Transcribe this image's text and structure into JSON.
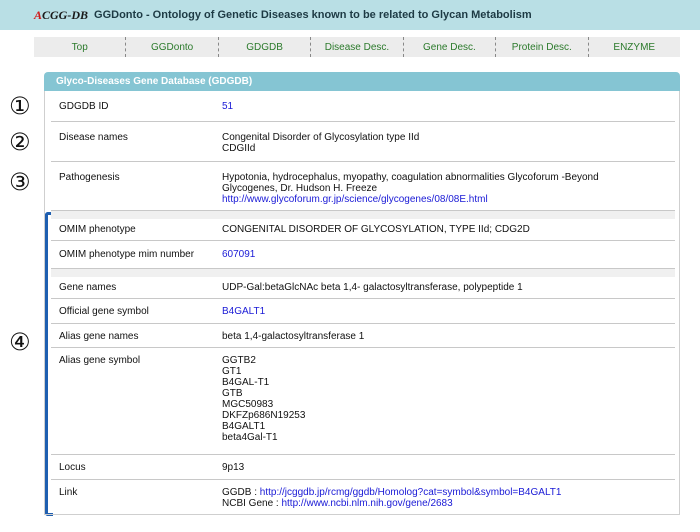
{
  "header": {
    "logo_a": "A",
    "logo_rest": "CGG-DB",
    "title": "GGDonto - Ontology of Genetic Diseases known to be related to Glycan Metabolism"
  },
  "nav": [
    "Top",
    "GGDonto",
    "GDGDB",
    "Disease Desc.",
    "Gene Desc.",
    "Protein Desc.",
    "ENZYME"
  ],
  "section_title": "Glyco-Diseases Gene Database (GDGDB)",
  "markers": [
    "①",
    "②",
    "③",
    "④"
  ],
  "rows": {
    "gdgdb_id": {
      "key": "GDGDB ID",
      "value": "51"
    },
    "disease_names": {
      "key": "Disease names",
      "lines": [
        "Congenital Disorder of Glycosylation type IId",
        "CDGIId"
      ]
    },
    "pathogenesis": {
      "key": "Pathogenesis",
      "lines": [
        "Hypotonia, hydrocephalus, myopathy, coagulation abnormalities Glycoforum -Beyond",
        "Glycogenes, Dr. Hudson H. Freeze"
      ],
      "link": "http://www.glycoforum.gr.jp/science/glycogenes/08/08E.html"
    },
    "omim_phenotype": {
      "key": "OMIM phenotype",
      "value": "CONGENITAL DISORDER OF GLYCOSYLATION, TYPE IId; CDG2D"
    },
    "omim_mim": {
      "key": "OMIM phenotype mim number",
      "value": "607091"
    },
    "gene_names": {
      "key": "Gene names",
      "value": "UDP-Gal:betaGlcNAc beta 1,4- galactosyltransferase, polypeptide 1"
    },
    "official_symbol": {
      "key": "Official gene symbol",
      "value": "B4GALT1"
    },
    "alias_names": {
      "key": "Alias gene names",
      "value": "beta 1,4-galactosyltransferase 1"
    },
    "alias_symbol": {
      "key": "Alias gene symbol",
      "lines": [
        "GGTB2",
        "GT1",
        "B4GAL-T1",
        "GTB",
        "MGC50983",
        "DKFZp686N19253",
        "B4GALT1",
        "beta4Gal-T1"
      ]
    },
    "locus": {
      "key": "Locus",
      "value": "9p13"
    },
    "link": {
      "key": "Link",
      "ggdb_label": "GGDB : ",
      "ggdb_url": "http://jcggdb.jp/rcmg/ggdb/Homolog?cat=symbol&symbol=B4GALT1",
      "ncbi_label": "NCBI Gene : ",
      "ncbi_url": "http://www.ncbi.nlm.nih.gov/gene/2683"
    }
  },
  "colors": {
    "header_bg": "#b9dfe5",
    "section_header_bg": "#85c5d3",
    "nav_link": "#2b7a2b",
    "link": "#1a1ad6",
    "bracket": "#1f5fb0",
    "logo_a": "#d01818"
  }
}
